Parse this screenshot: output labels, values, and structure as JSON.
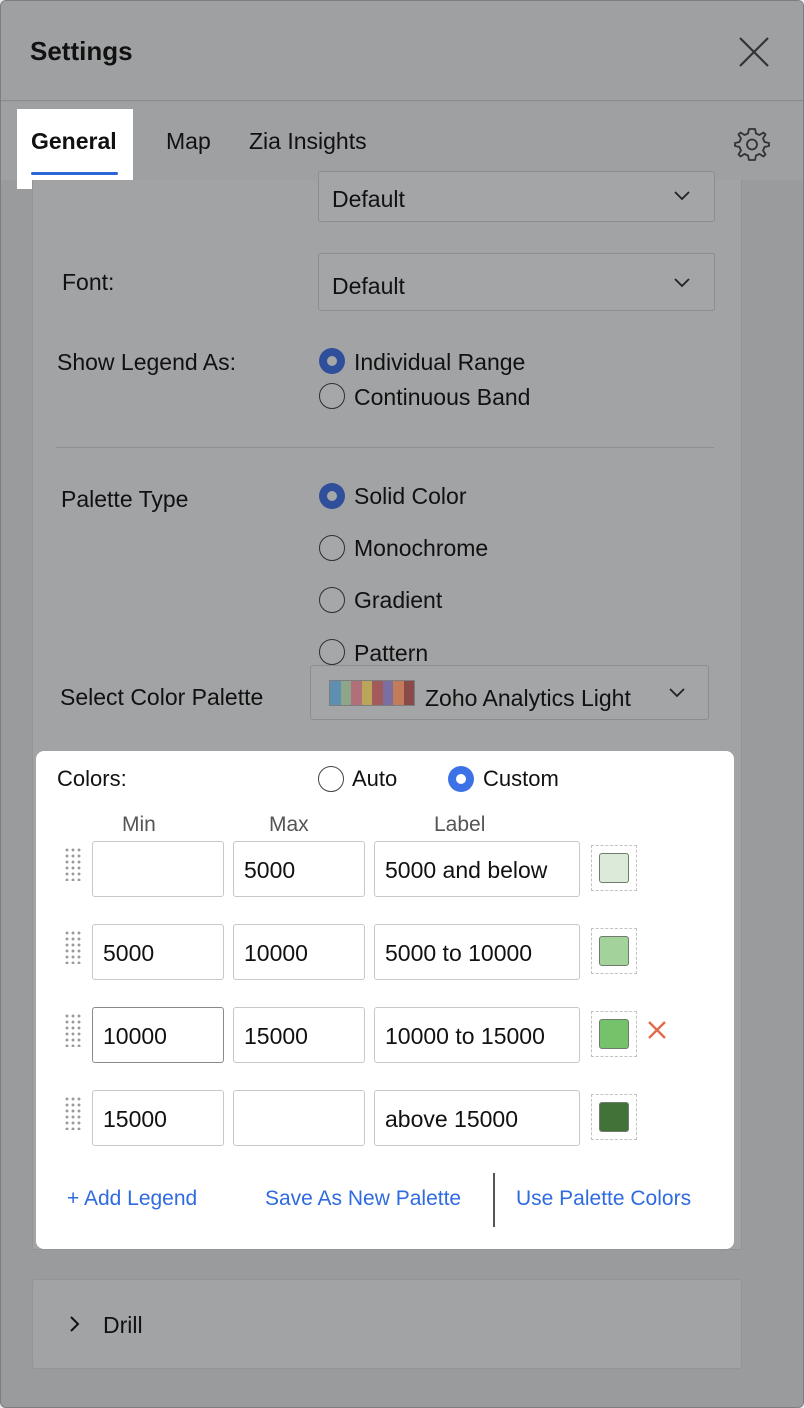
{
  "header": {
    "title": "Settings",
    "close_icon": "close-icon"
  },
  "tabs": [
    {
      "label": "General",
      "active": true
    },
    {
      "label": "Map",
      "active": false
    },
    {
      "label": "Zia Insights",
      "active": false
    }
  ],
  "form": {
    "top_select_value": "Default",
    "font": {
      "label": "Font:",
      "value": "Default"
    },
    "legend": {
      "label": "Show Legend As:",
      "options": [
        "Individual Range",
        "Continuous Band"
      ],
      "selected": "Individual Range"
    },
    "palette_type": {
      "label": "Palette Type",
      "options": [
        "Solid Color",
        "Monochrome",
        "Gradient",
        "Pattern"
      ],
      "selected": "Solid Color"
    },
    "color_palette": {
      "label": "Select Color Palette",
      "value": "Zoho Analytics Light",
      "strip_colors": [
        "#5f8fb0",
        "#8fa58a",
        "#b0707a",
        "#b9a65a",
        "#a35a5a",
        "#7a6f9f",
        "#c27c5a",
        "#8a4a4a"
      ]
    }
  },
  "colors": {
    "label": "Colors:",
    "options": [
      "Auto",
      "Custom"
    ],
    "selected": "Custom",
    "headers": {
      "min": "Min",
      "max": "Max",
      "label": "Label"
    },
    "rows": [
      {
        "min": "",
        "max": "5000",
        "label": "5000 and below",
        "color": "#dcebd9"
      },
      {
        "min": "5000",
        "max": "10000",
        "label": "5000 to 10000",
        "color": "#a3d39b"
      },
      {
        "min": "10000",
        "max": "15000",
        "label": "10000 to 15000",
        "color": "#74c36b"
      },
      {
        "min": "15000",
        "max": "",
        "label": "above 15000",
        "color": "#427238"
      }
    ],
    "links": {
      "add": "+ Add Legend",
      "save": "Save As New Palette",
      "use": "Use Palette Colors"
    }
  },
  "drill": {
    "label": "Drill"
  }
}
